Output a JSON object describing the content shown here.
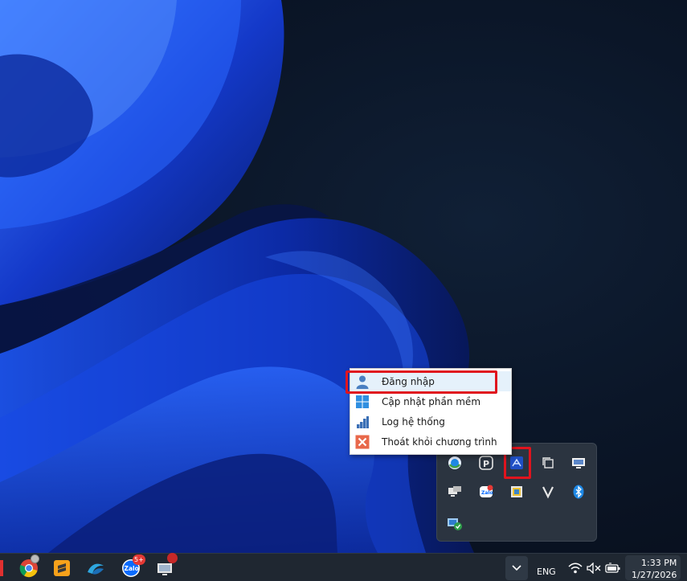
{
  "context_menu": {
    "items": [
      {
        "label": "Đăng nhập",
        "icon": "user-icon"
      },
      {
        "label": "Cập nhật phần mềm",
        "icon": "windows-icon"
      },
      {
        "label": "Log hệ thống",
        "icon": "bar-chart-icon"
      },
      {
        "label": "Thoát khỏi chương trình",
        "icon": "close-x-icon"
      }
    ]
  },
  "tray_flyout": {
    "icons": [
      "chrome-remote-icon",
      "p-app-icon",
      "highlighted-app-icon",
      "copy-icon",
      "monitor-icon",
      "network-display-icon",
      "zalo-tray-icon",
      "flag-app-icon",
      "v-app-icon",
      "bluetooth-icon",
      "security-shield-icon"
    ]
  },
  "taskbar": {
    "apps": [
      "red-app-icon",
      "chrome-icon",
      "sublime-icon",
      "edge-like-icon",
      "zalo-icon",
      "remote-desktop-icon"
    ],
    "zalo_badge": "5+",
    "chrome_badge": "",
    "language": "ENG",
    "time": "1:33 PM",
    "date": "1/27/2026"
  },
  "colors": {
    "highlight_red": "#e0141e",
    "menu_hover": "#e5f1fb",
    "taskbar": "#1f2731",
    "flyout": "#2b3440"
  }
}
